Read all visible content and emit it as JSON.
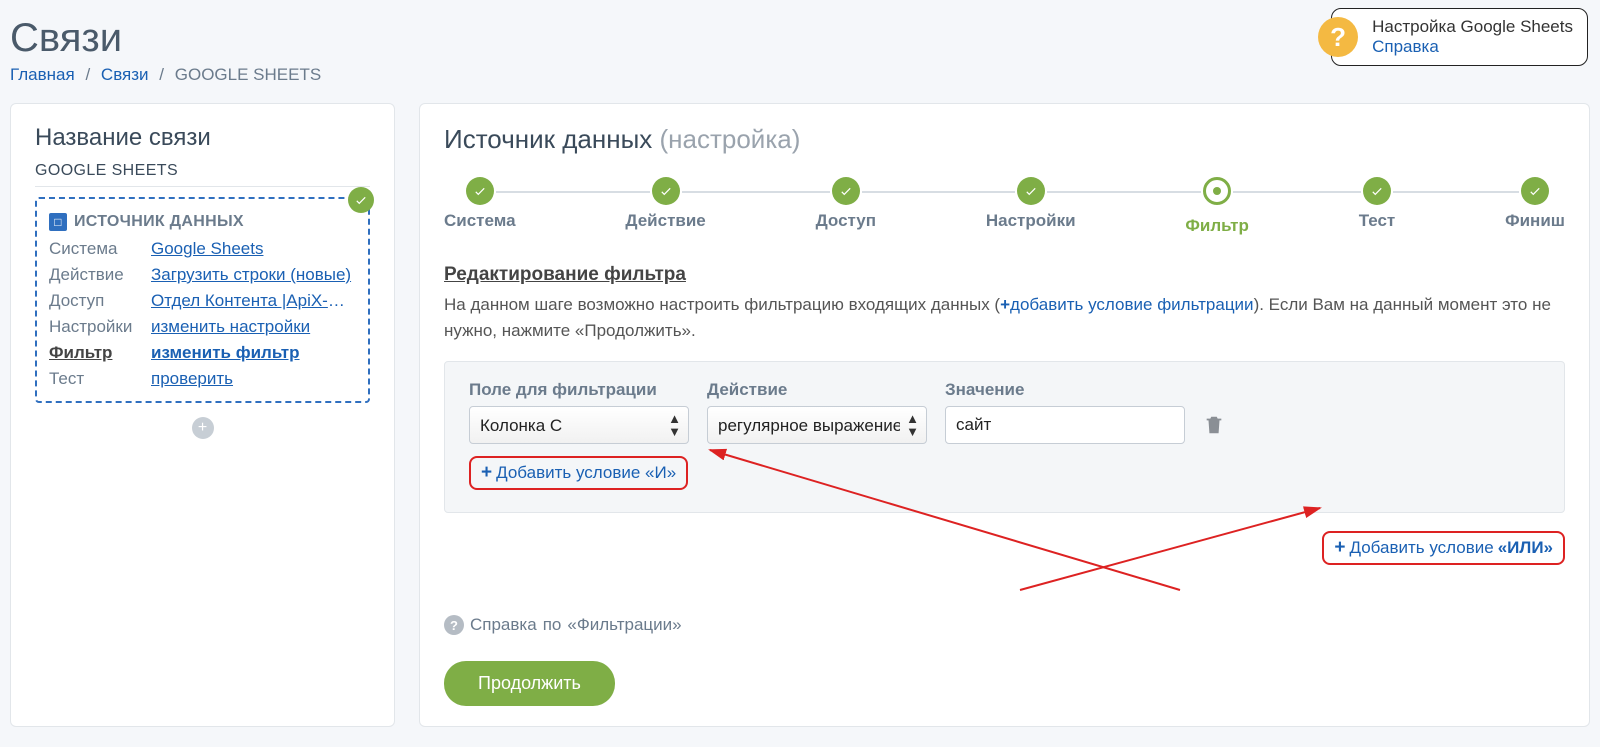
{
  "page": {
    "title": "Связи"
  },
  "breadcrumb": {
    "home": "Главная",
    "links": "Связи",
    "current": "GOOGLE SHEETS"
  },
  "helpBadge": {
    "title": "Настройка Google Sheets",
    "link": "Справка"
  },
  "sidebar": {
    "heading": "Название связи",
    "subtitle": "GOOGLE SHEETS",
    "sourceBoxTitle": "ИСТОЧНИК ДАННЫХ",
    "rows": [
      {
        "key": "Система",
        "value": "Google Sheets",
        "active": false
      },
      {
        "key": "Действие",
        "value": "Загрузить строки (новые)",
        "active": false
      },
      {
        "key": "Доступ",
        "value": "Отдел Контента |ApiX-Drive",
        "active": false
      },
      {
        "key": "Настройки",
        "value": "изменить настройки",
        "active": false
      },
      {
        "key": "Фильтр",
        "value": "изменить фильтр",
        "active": true
      },
      {
        "key": "Тест",
        "value": "проверить",
        "active": false
      }
    ]
  },
  "main": {
    "title": "Источник данных",
    "titleMuted": "(настройка)",
    "steps": [
      {
        "label": "Система",
        "state": "done"
      },
      {
        "label": "Действие",
        "state": "done"
      },
      {
        "label": "Доступ",
        "state": "done"
      },
      {
        "label": "Настройки",
        "state": "done"
      },
      {
        "label": "Фильтр",
        "state": "current"
      },
      {
        "label": "Тест",
        "state": "done"
      },
      {
        "label": "Финиш",
        "state": "done"
      }
    ],
    "sectionTitle": "Редактирование фильтра",
    "descPre": "На данном шаге возможно настроить фильтрацию входящих данных (",
    "descLink": "добавить условие фильтрации",
    "descPost": "). Если Вам на данный момент это не нужно, нажмите «Продолжить».",
    "filter": {
      "fieldLabel": "Поле для фильтрации",
      "fieldValue": "Колонка C",
      "actionLabel": "Действие",
      "actionValue": "регулярное выражение",
      "valueLabel": "Значение",
      "valueValue": "сайт",
      "addAnd": "Добавить условие «И»",
      "addOrPrefix": "Добавить условие ",
      "addOrBold": "«ИЛИ»"
    },
    "helpLine": {
      "pre": "Справка",
      "mid": " по ",
      "topic": "«Фильтрации»"
    },
    "continueLabel": "Продолжить"
  }
}
